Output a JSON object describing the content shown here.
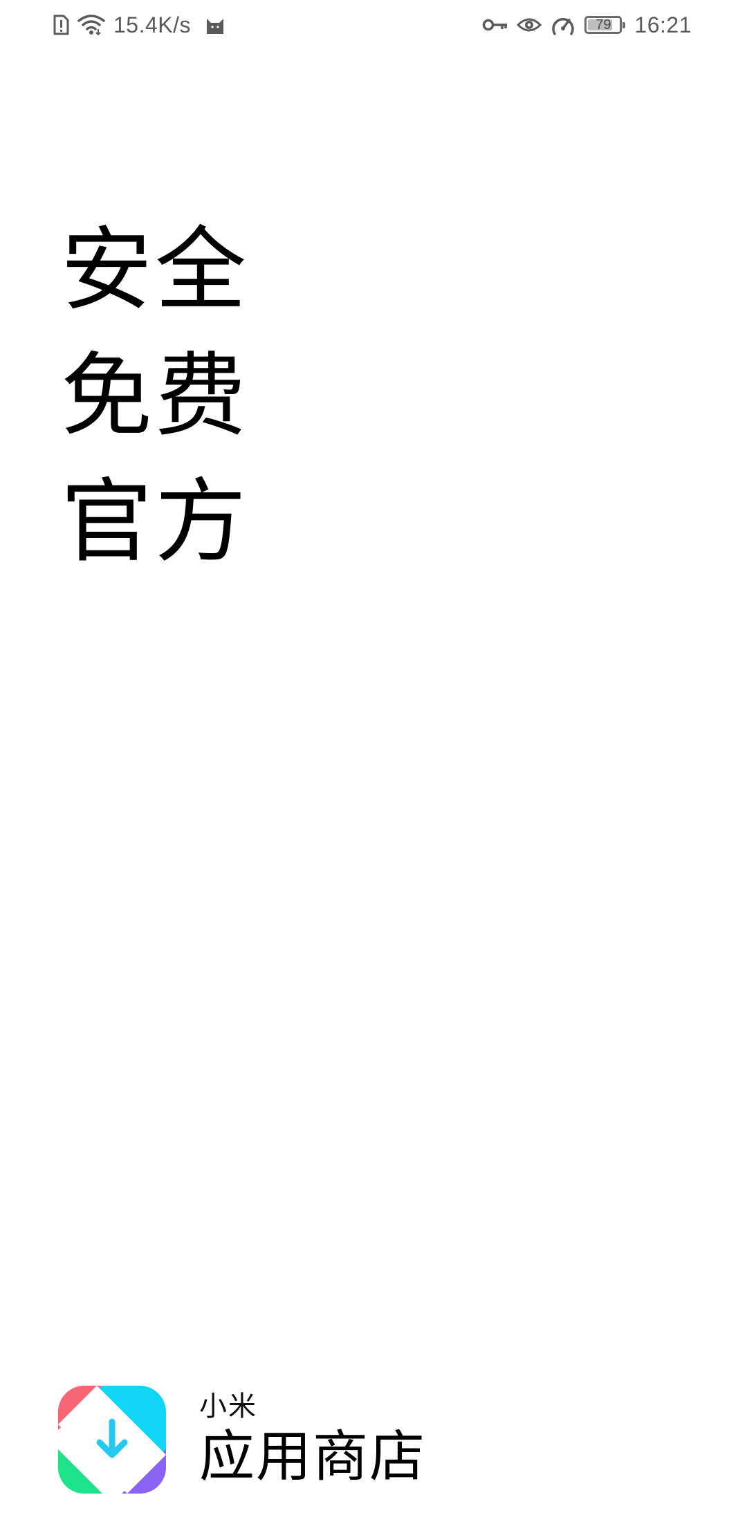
{
  "status_bar": {
    "net_speed": "15.4K/s",
    "battery_level": "79",
    "battery_fraction": 0.79,
    "time": "16:21",
    "left_icons": [
      "sim-alert-icon",
      "wifi-icon",
      "cat-app-icon"
    ],
    "right_icons": [
      "key-icon",
      "eye-icon",
      "speed-icon",
      "battery-icon"
    ]
  },
  "slogans": {
    "line1": "安全",
    "line2": "免费",
    "line3": "官方"
  },
  "brand": {
    "subtitle": "小米",
    "title": "应用商店",
    "logo_icon": "mi-app-store-logo",
    "logo_colors": {
      "top_left": "#f86676",
      "top_right": "#11d5f5",
      "bottom_left": "#1ee38a",
      "bottom_right": "#8a63f5",
      "arrow": "#23c9f0"
    }
  }
}
